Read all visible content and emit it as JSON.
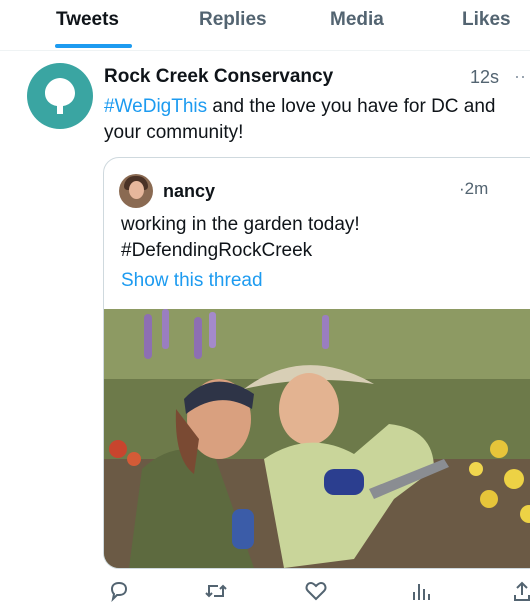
{
  "tabs": [
    {
      "label": "Tweets"
    },
    {
      "label": "Replies"
    },
    {
      "label": "Media"
    },
    {
      "label": "Likes"
    }
  ],
  "tweet": {
    "author": "Rock Creek Conservancy",
    "time": "12s",
    "more": "··",
    "hashtag": "#WeDigThis",
    "text_rest": " and the love you have for DC and your community!"
  },
  "quoted": {
    "author": "nancy",
    "time": "·2m",
    "text_line1": "working in the garden today!",
    "text_line2": "#DefendingRockCreek",
    "thread_link": "Show this thread"
  },
  "actions": [
    "reply-icon",
    "retweet-icon",
    "like-icon",
    "views-icon",
    "share-icon"
  ],
  "colors": {
    "accent": "#1d9bf0",
    "avatar_teal": "#3aa5a2",
    "muted": "#536471"
  }
}
